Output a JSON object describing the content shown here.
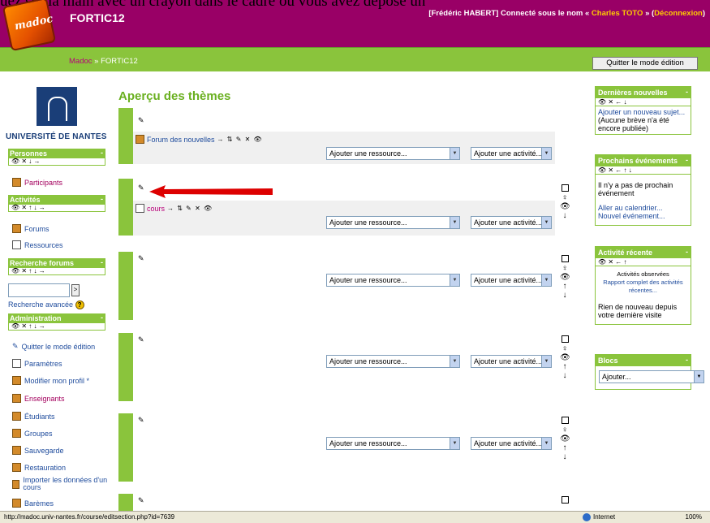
{
  "top_text": "uez sur la main avec un crayon dans le cadre où vous avez déposé un",
  "header": {
    "logo_text": "madoc",
    "site_title": "FORTIC12",
    "login_user": "[Frédéric HABERT] Connecté sous le nom « ",
    "login_as": "Charles TOTO",
    "login_mid": " » (",
    "logout": "Déconnexion",
    "login_end": ")"
  },
  "navbar": {
    "home": "Madoc",
    "separator": " » ",
    "current": "FORTIC12",
    "edit_button": "Quitter le mode édition"
  },
  "left": {
    "university": "UNIVERSITÉ DE NANTES",
    "blocks": {
      "personnes": "Personnes",
      "activites": "Activités",
      "recherche": "Recherche forums",
      "administration": "Administration"
    },
    "controls_3": "👁 ✕ ↓ →",
    "controls_4": "👁 ✕ ↑ ↓ →",
    "participants": "Participants",
    "forums": "Forums",
    "ressources": "Ressources",
    "search_go": ">",
    "advanced_search": "Recherche avancée",
    "admin_items": [
      "Quitter le mode édition",
      "Paramètres",
      "Modifier mon profil *",
      "Enseignants",
      "Étudiants",
      "Groupes",
      "Sauvegarde",
      "Restauration",
      "Importer les données d'un cours",
      "Barèmes"
    ]
  },
  "main": {
    "title": "Aperçu des thèmes",
    "forum_link": "Forum des nouvelles",
    "cours_link": "cours",
    "item_actions": "→ ⇅ ✎ ✕ 👁",
    "add_resource": "Ajouter une ressource...",
    "add_activity": "Ajouter une activité..."
  },
  "right": {
    "news_title": "Dernières nouvelles",
    "news_controls": "👁 ✕ ← ↓",
    "news_add": "Ajouter un nouveau sujet...",
    "news_none": "(Aucune brève n'a été encore publiée)",
    "events_title": "Prochains événements",
    "events_controls": "👁 ✕ ← ↑ ↓",
    "events_none": "Il n'y a pas de prochain événement",
    "events_calendar": "Aller au calendrier...",
    "events_new": "Nouvel événement...",
    "recent_title": "Activité récente",
    "recent_controls": "👁 ✕ ← ↑",
    "recent_observed": "Activités observées",
    "recent_report": "Rapport complet des activités récentes...",
    "recent_none": "Rien de nouveau depuis votre dernière visite",
    "blocks_title": "Blocs",
    "blocks_select": "Ajouter..."
  },
  "status": {
    "url": "http://madoc.univ-nantes.fr/course/editsection.php?id=7639",
    "zone": "Internet",
    "zoom": "100%"
  },
  "colors": {
    "header": "#990066",
    "green": "#8ac43c",
    "link": "#1e4b9c",
    "magenta_link": "#b8007a",
    "arrow": "#dd0000"
  }
}
